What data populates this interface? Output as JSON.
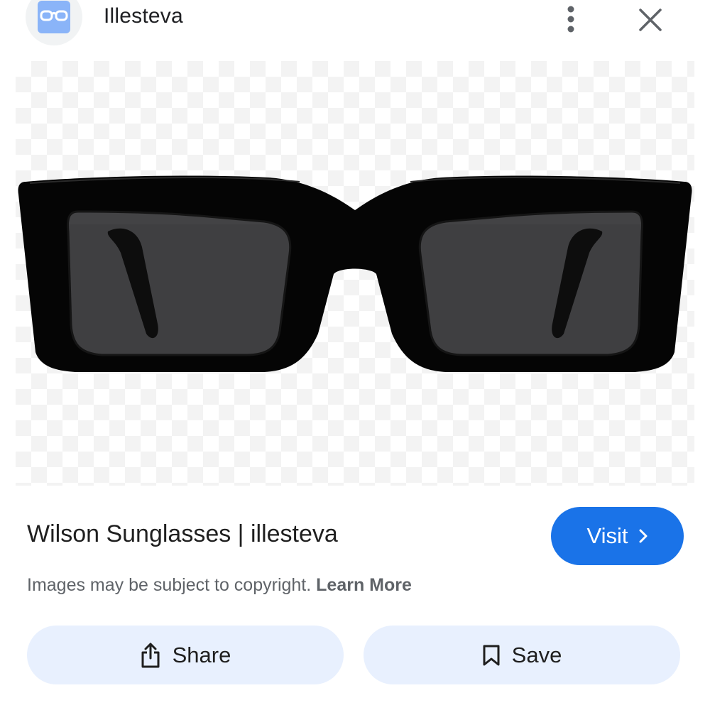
{
  "header": {
    "site_name": "Illesteva",
    "avatar_icon": "glasses-icon",
    "more_icon": "more-vert-icon",
    "close_icon": "close-icon"
  },
  "image": {
    "subject_icon": "sunglasses-image",
    "frame_color": "#050505",
    "lens_color": "#3f3f41"
  },
  "result": {
    "title": "Wilson Sunglasses | illesteva",
    "visit_label": "Visit",
    "visit_icon": "chevron-right-icon",
    "copyright_text": "Images may be subject to copyright.",
    "learn_more_label": "Learn More"
  },
  "actions": {
    "share_label": "Share",
    "share_icon": "share-icon",
    "save_label": "Save",
    "save_icon": "bookmark-icon"
  },
  "colors": {
    "accent": "#1a73e8",
    "button_bg": "#e8f0fe",
    "avatar_bg": "#f1f3f4",
    "avatar_icon": "#8ab4f8"
  }
}
